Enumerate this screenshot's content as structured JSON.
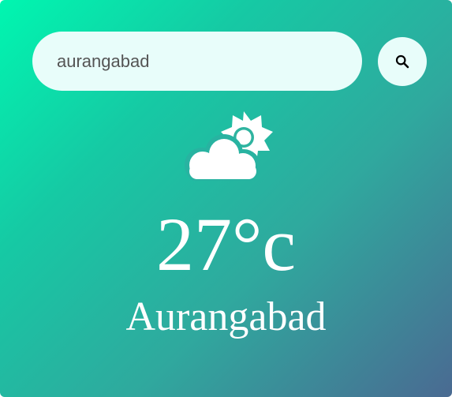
{
  "search": {
    "value": "aurangabad",
    "button_icon": "search-icon"
  },
  "weather": {
    "icon": "partly-cloudy-day-icon",
    "temperature": "27°c",
    "city": "Aurangabad"
  },
  "colors": {
    "gradient_start": "#00f6b0",
    "gradient_end": "#4a6a92",
    "input_background": "#e8fdfa",
    "text": "#ffffff"
  }
}
